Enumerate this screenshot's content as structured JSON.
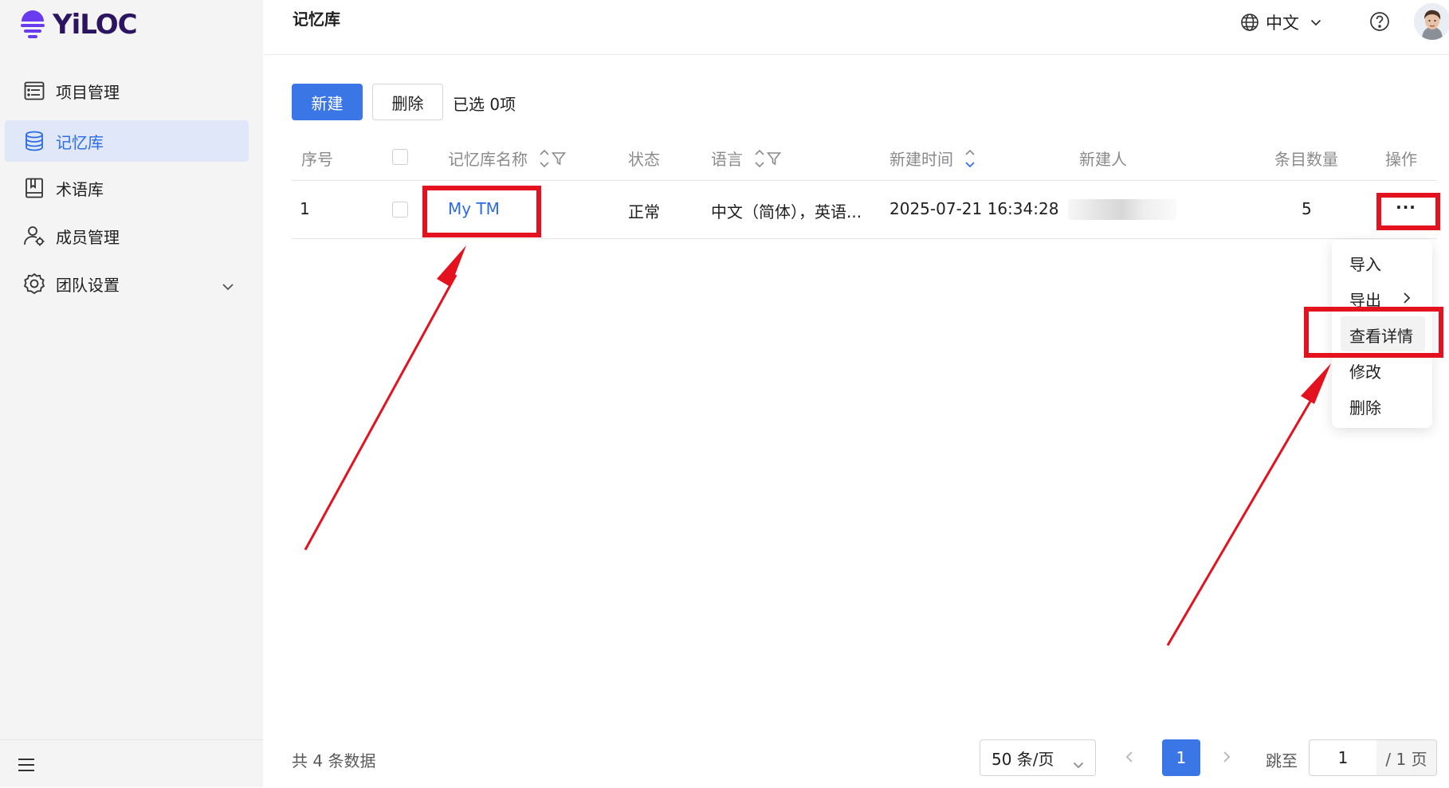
{
  "brand": {
    "name": "YiLOC"
  },
  "sidebar": {
    "items": [
      {
        "label": "项目管理",
        "icon": "project-list-icon"
      },
      {
        "label": "记忆库",
        "icon": "database-icon",
        "active": true
      },
      {
        "label": "术语库",
        "icon": "book-icon"
      },
      {
        "label": "成员管理",
        "icon": "user-settings-icon"
      },
      {
        "label": "团队设置",
        "icon": "gear-icon",
        "expandable": true
      }
    ],
    "menu_toggle_icon": "hamburger-icon"
  },
  "header": {
    "title": "记忆库",
    "language": "中文",
    "help_icon": "help-circle-icon"
  },
  "toolbar": {
    "new_label": "新建",
    "delete_label": "删除",
    "selected_text": "已选 0项"
  },
  "table": {
    "columns": [
      "序号",
      "记忆库名称",
      "状态",
      "语言",
      "新建时间",
      "新建人",
      "条目数量",
      "操作"
    ],
    "rows": [
      {
        "index": "1",
        "name": "My TM",
        "status": "正常",
        "language": "中文（简体），英语...",
        "created": "2025-07-21 16:34:28",
        "creator": "",
        "count": "5",
        "action": "···"
      }
    ]
  },
  "dropdown": {
    "items": [
      "导入",
      "导出",
      "查看详情",
      "修改",
      "删除"
    ]
  },
  "pagination": {
    "total_text": "共 4 条数据",
    "page_size": "50 条/页",
    "current_page": "1",
    "jump_label": "跳至",
    "jump_value": "1",
    "total_pages_text": "/ 1 页"
  },
  "colors": {
    "primary": "#3b76e6",
    "annotation_red": "#e3121e",
    "sidebar_bg": "#f4f4f5",
    "active_bg": "#dfe7f8"
  }
}
